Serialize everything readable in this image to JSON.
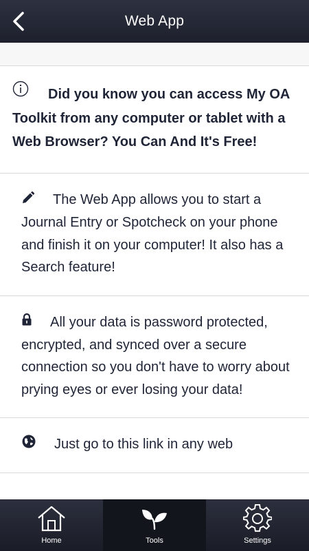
{
  "header": {
    "title": "Web App",
    "back_icon": "chevron-left-icon"
  },
  "cards": [
    {
      "icon": "info-circle-icon",
      "text": "Did you know you can access My OA Toolkit from any computer or tablet with a Web Browser? You Can And It's Free!"
    },
    {
      "icon": "pencil-icon",
      "text": "The Web App allows you to start a Journal Entry or Spotcheck on your phone and finish it on your computer! It also has a Search feature!"
    },
    {
      "icon": "lock-icon",
      "text": "All your data is password protected, encrypted, and synced over a secure connection so you don't have to worry about prying eyes or ever losing your data!"
    },
    {
      "icon": "globe-icon",
      "text": "Just go to this link in any web"
    }
  ],
  "tabbar": {
    "tabs": [
      {
        "label": "Home",
        "icon": "home-icon",
        "active": false
      },
      {
        "label": "Tools",
        "icon": "sprout-icon",
        "active": true
      },
      {
        "label": "Settings",
        "icon": "gear-icon",
        "active": false
      }
    ]
  },
  "colors": {
    "header_bg": "#23263300",
    "text": "#1f2436",
    "divider": "#d9d9d9",
    "active_tab_bg": "#13151d"
  }
}
